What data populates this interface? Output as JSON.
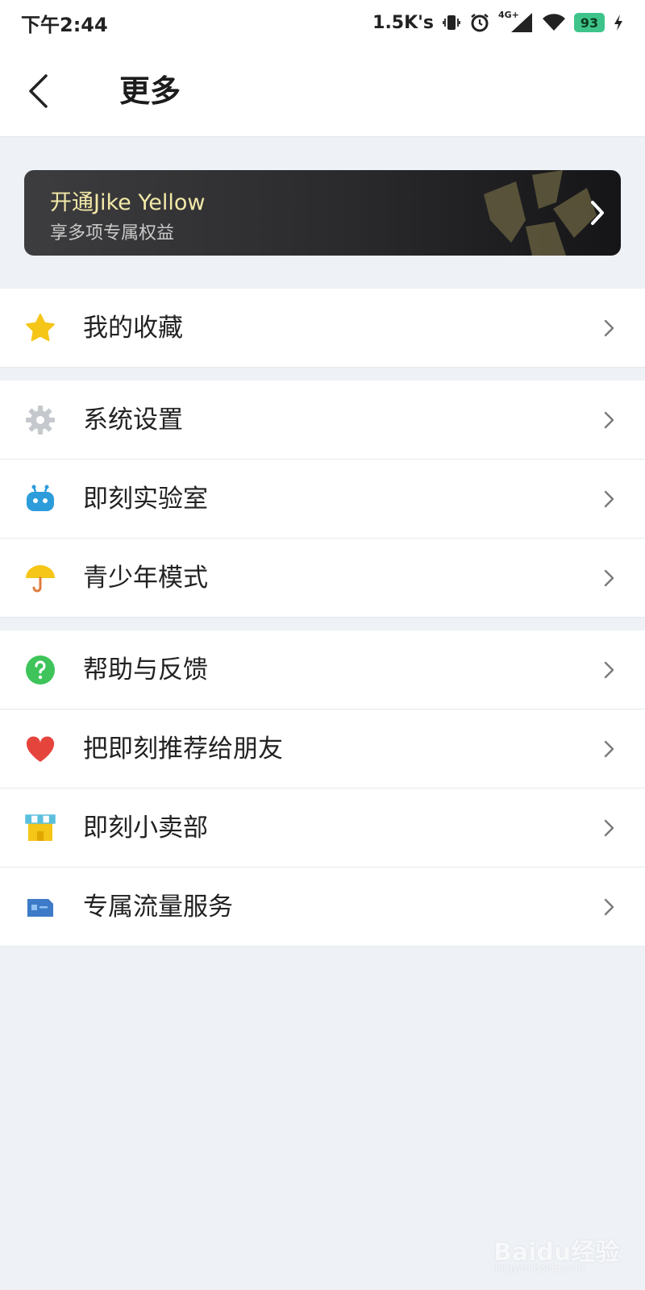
{
  "status_bar": {
    "time": "下午2:44",
    "network_speed": "1.5K's",
    "network_type": "4G+",
    "battery": "93"
  },
  "header": {
    "title": "更多",
    "back_icon": "chevron-left-icon"
  },
  "promo": {
    "title": "开通Jike Yellow",
    "subtitle": "享多项专属权益"
  },
  "groups": [
    {
      "items": [
        {
          "label": "我的收藏",
          "icon": "star-icon",
          "color": "#f5c518"
        }
      ]
    },
    {
      "items": [
        {
          "label": "系统设置",
          "icon": "gear-icon",
          "color": "#c5c8cc"
        },
        {
          "label": "即刻实验室",
          "icon": "robot-icon",
          "color": "#2d9cdb"
        },
        {
          "label": "青少年模式",
          "icon": "umbrella-icon",
          "color": "#f5c518"
        }
      ]
    },
    {
      "items": [
        {
          "label": "帮助与反馈",
          "icon": "question-icon",
          "color": "#3ec45a"
        },
        {
          "label": "把即刻推荐给朋友",
          "icon": "heart-icon",
          "color": "#e5443d"
        },
        {
          "label": "即刻小卖部",
          "icon": "store-icon",
          "color": "#f5c518"
        },
        {
          "label": "专属流量服务",
          "icon": "sim-card-icon",
          "color": "#3d7ac7"
        }
      ]
    }
  ],
  "watermark": {
    "text": "Baidu经验",
    "sub": "jingyan.baidu.com"
  }
}
